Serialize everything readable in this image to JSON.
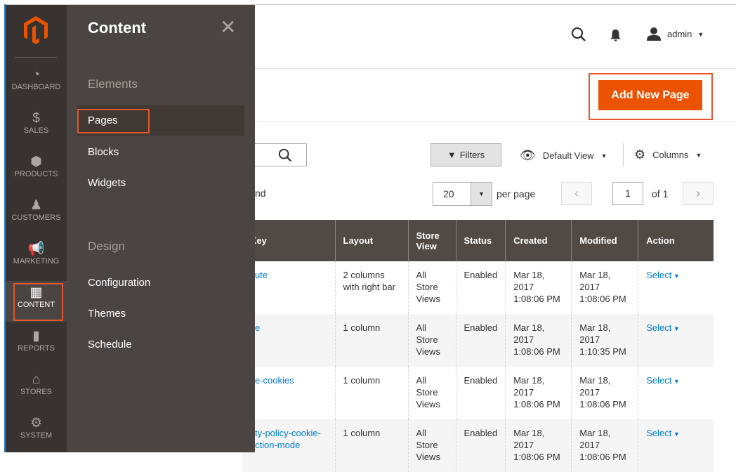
{
  "sidebar": {
    "items": [
      {
        "label": "DASHBOARD",
        "icon": "dashboard-icon"
      },
      {
        "label": "SALES",
        "icon": "dollar-icon"
      },
      {
        "label": "PRODUCTS",
        "icon": "box-icon"
      },
      {
        "label": "CUSTOMERS",
        "icon": "person-icon"
      },
      {
        "label": "MARKETING",
        "icon": "megaphone-icon"
      },
      {
        "label": "CONTENT",
        "icon": "layout-icon",
        "active": true
      },
      {
        "label": "REPORTS",
        "icon": "bar-chart-icon"
      },
      {
        "label": "STORES",
        "icon": "store-icon"
      },
      {
        "label": "SYSTEM",
        "icon": "gear-icon"
      }
    ]
  },
  "flyout": {
    "title": "Content",
    "sections": [
      {
        "title": "Elements",
        "items": [
          "Pages",
          "Blocks",
          "Widgets"
        ]
      },
      {
        "title": "Design",
        "items": [
          "Configuration",
          "Themes",
          "Schedule"
        ]
      }
    ]
  },
  "header": {
    "user": "admin"
  },
  "actions": {
    "add_new_page": "Add New Page",
    "filters": "Filters",
    "default_view": "Default View",
    "columns": "Columns"
  },
  "grid": {
    "records_fragment": "nd",
    "per_page_value": "20",
    "per_page_label": "per page",
    "page": "1",
    "of_pages": "of 1",
    "headers": [
      "Key",
      "Layout",
      "Store View",
      "Status",
      "Created",
      "Modified",
      "Action"
    ],
    "rows": [
      [
        "ute",
        "2 columns with right bar",
        "All Store Views",
        "Enabled",
        "Mar 18, 2017 1:08:06 PM",
        "Mar 18, 2017 1:08:06 PM",
        "Select"
      ],
      [
        "e",
        "1 column",
        "All Store Views",
        "Enabled",
        "Mar 18, 2017 1:08:06 PM",
        "Mar 18, 2017 1:10:35 PM",
        "Select"
      ],
      [
        "e-cookies",
        "1 column",
        "All Store Views",
        "Enabled",
        "Mar 18, 2017 1:08:06 PM",
        "Mar 18, 2017 1:08:06 PM",
        "Select"
      ],
      [
        "ty-policy-cookie-ction-mode",
        "1 column",
        "All Store Views",
        "Enabled",
        "Mar 18, 2017 1:08:06 PM",
        "Mar 18, 2017 1:08:06 PM",
        "Select"
      ]
    ]
  },
  "colors": {
    "accent": "#eb5202",
    "highlight": "#e4572e",
    "sidebar": "#373330",
    "flyout": "#4a4542",
    "table_header": "#514943",
    "link": "#007bdb"
  }
}
